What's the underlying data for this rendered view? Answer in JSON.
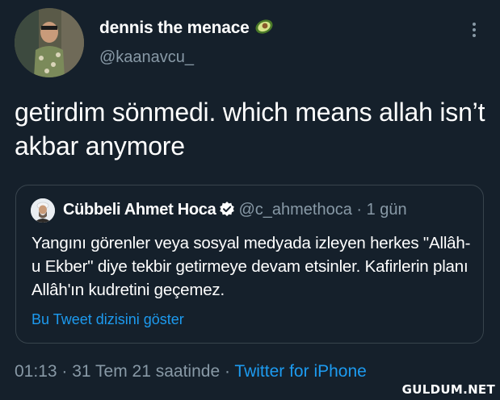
{
  "tweet": {
    "display_name": "dennis the menace",
    "name_emoji_icon": "avocado-icon",
    "handle": "@kaanavcu_",
    "text": "getirdim sönmedi. which means allah isn’t akbar anymore",
    "timestamp": "01:13 · 31 Tem 21 saatinde",
    "meta_separator": " · ",
    "source": "Twitter for iPhone"
  },
  "quoted": {
    "name": "Cübbeli Ahmet Hoca",
    "verified_icon": "verified-badge-icon",
    "handle": "@c_ahmethoca",
    "separator": " · ",
    "time": "1 gün",
    "text": "Yangını görenler veya sosyal medyada izleyen herkes \"Allâh-u Ekber\" diye tekbir getirmeye devam etsinler. Kafirlerin planı Allâh'ın kudretini geçemez.",
    "show_thread": "Bu Tweet dizisini göster"
  },
  "watermark": "GULDUM.NET",
  "colors": {
    "background": "#15202b",
    "secondary_text": "#8899a6",
    "link": "#1d9bf0",
    "border": "#38444d"
  }
}
